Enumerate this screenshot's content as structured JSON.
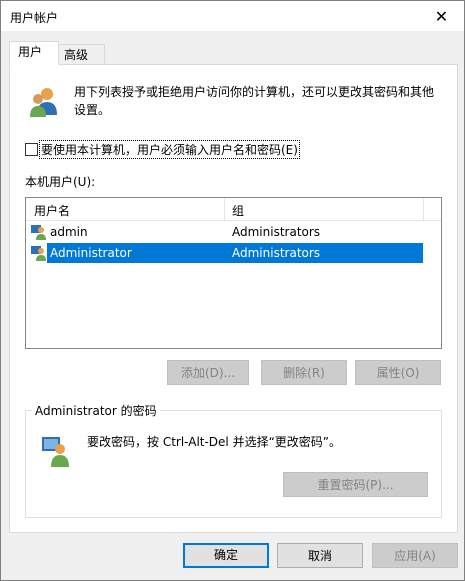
{
  "window": {
    "title": "用户帐户",
    "close_glyph": "✕"
  },
  "tabs": [
    {
      "label": "用户",
      "active": true
    },
    {
      "label": "高级",
      "active": false
    }
  ],
  "intro_text": "用下列表授予或拒绝用户访问你的计算机，还可以更改其密码和其他设置。",
  "require_login_checkbox": {
    "label": "要使用本计算机，用户必须输入用户名和密码(E)",
    "checked": false
  },
  "local_users_label": "本机用户(U):",
  "table": {
    "columns": [
      "用户名",
      "组"
    ],
    "rows": [
      {
        "name": "admin",
        "group": "Administrators",
        "selected": false
      },
      {
        "name": "Administrator",
        "group": "Administrators",
        "selected": true
      }
    ]
  },
  "buttons": {
    "add": "添加(D)...",
    "remove": "删除(R)",
    "properties": "属性(O)",
    "reset_password": "重置密码(P)...",
    "ok": "确定",
    "cancel": "取消",
    "apply": "应用(A)"
  },
  "password_group": {
    "title": "Administrator 的密码",
    "text": "要改密码，按 Ctrl-Alt-Del 并选择“更改密码”。"
  },
  "colors": {
    "selection": "#0078d7",
    "panel_bg": "#f0f0f0"
  }
}
